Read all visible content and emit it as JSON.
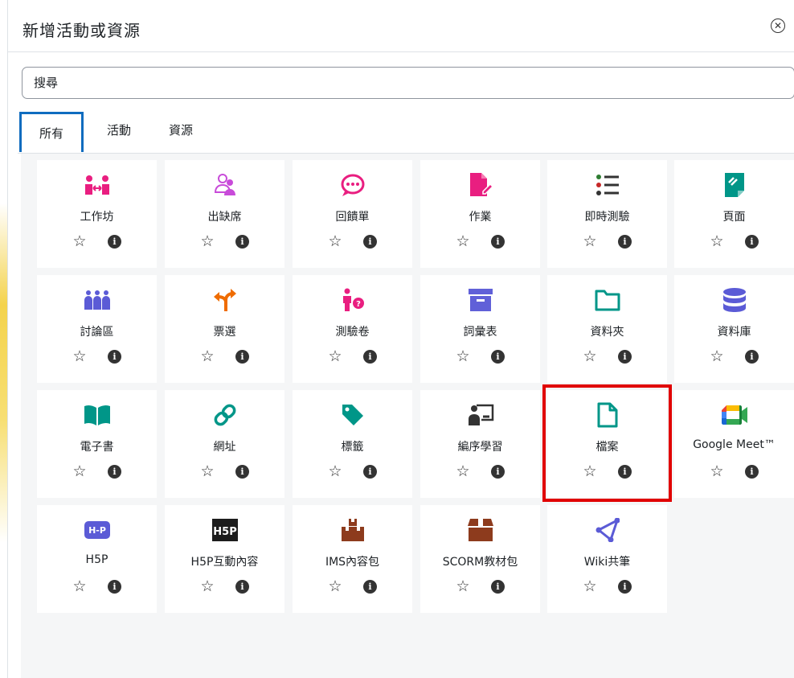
{
  "modal": {
    "title": "新增活動或資源",
    "close_icon": "close-icon"
  },
  "search": {
    "placeholder": "搜尋"
  },
  "tabs": [
    {
      "label": "所有",
      "active": true
    },
    {
      "label": "活動",
      "active": false
    },
    {
      "label": "資源",
      "active": false
    }
  ],
  "colors": {
    "accent": "#0f6cbf",
    "highlight": "#e00000"
  },
  "items": [
    {
      "label": "工作坊",
      "icon": "workshop-icon"
    },
    {
      "label": "出缺席",
      "icon": "attendance-icon"
    },
    {
      "label": "回饋單",
      "icon": "feedback-icon"
    },
    {
      "label": "作業",
      "icon": "assignment-icon"
    },
    {
      "label": "即時測驗",
      "icon": "quiz-list-icon"
    },
    {
      "label": "頁面",
      "icon": "page-icon"
    },
    {
      "label": "討論區",
      "icon": "forum-icon"
    },
    {
      "label": "票選",
      "icon": "choice-icon"
    },
    {
      "label": "測驗卷",
      "icon": "quiz-icon"
    },
    {
      "label": "詞彙表",
      "icon": "glossary-icon"
    },
    {
      "label": "資料夾",
      "icon": "folder-icon"
    },
    {
      "label": "資料庫",
      "icon": "database-icon"
    },
    {
      "label": "電子書",
      "icon": "book-icon"
    },
    {
      "label": "網址",
      "icon": "url-icon"
    },
    {
      "label": "標籤",
      "icon": "label-icon"
    },
    {
      "label": "編序學習",
      "icon": "lesson-icon"
    },
    {
      "label": "檔案",
      "icon": "file-icon",
      "highlighted": true
    },
    {
      "label": "Google Meet™",
      "icon": "google-meet-icon"
    },
    {
      "label": "H5P",
      "icon": "h5p-icon"
    },
    {
      "label": "H5P互動內容",
      "icon": "h5p-interactive-icon"
    },
    {
      "label": "IMS內容包",
      "icon": "ims-package-icon"
    },
    {
      "label": "SCORM教材包",
      "icon": "scorm-package-icon"
    },
    {
      "label": "Wiki共筆",
      "icon": "wiki-icon"
    }
  ],
  "star_glyph": "☆",
  "info_glyph": "i"
}
